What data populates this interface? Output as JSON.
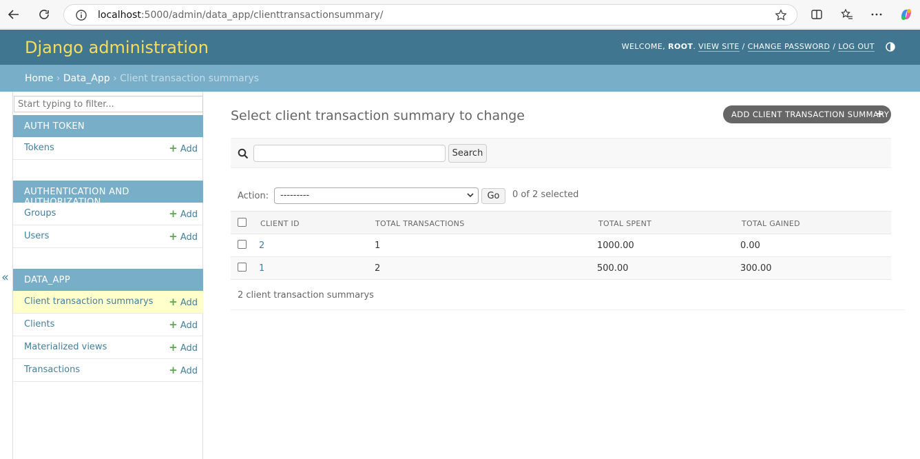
{
  "browser": {
    "url_host": "localhost",
    "url_rest": ":5000/admin/data_app/clienttransactionsummary/"
  },
  "header": {
    "brand": "Django administration",
    "welcome": "WELCOME,",
    "user": "ROOT",
    "view_site": "VIEW SITE",
    "change_password": "CHANGE PASSWORD",
    "log_out": "LOG OUT",
    "sep": "/"
  },
  "breadcrumbs": {
    "home": "Home",
    "app": "Data_App",
    "current": "Client transaction summarys",
    "sep": "›"
  },
  "sidebar": {
    "filter_placeholder": "Start typing to filter...",
    "collapse": "«",
    "add_label": "Add",
    "modules": [
      {
        "title": "AUTH TOKEN",
        "items": [
          {
            "label": "Tokens"
          }
        ]
      },
      {
        "title": "AUTHENTICATION AND AUTHORIZATION",
        "items": [
          {
            "label": "Groups"
          },
          {
            "label": "Users"
          }
        ]
      },
      {
        "title": "DATA_APP",
        "items": [
          {
            "label": "Client transaction summarys"
          },
          {
            "label": "Clients"
          },
          {
            "label": "Materialized views"
          },
          {
            "label": "Transactions"
          }
        ]
      }
    ]
  },
  "main": {
    "title": "Select client transaction summary to change",
    "add_button": "ADD CLIENT TRANSACTION SUMMARY",
    "search_button": "Search",
    "action_label": "Action:",
    "action_value": "---------",
    "go_button": "Go",
    "selected_count": "0 of 2 selected",
    "columns": [
      "CLIENT ID",
      "TOTAL TRANSACTIONS",
      "TOTAL SPENT",
      "TOTAL GAINED"
    ],
    "rows": [
      {
        "client_id": "2",
        "total_transactions": "1",
        "total_spent": "1000.00",
        "total_gained": "0.00"
      },
      {
        "client_id": "1",
        "total_transactions": "2",
        "total_spent": "500.00",
        "total_gained": "300.00"
      }
    ],
    "paginator": "2 client transaction summarys"
  }
}
